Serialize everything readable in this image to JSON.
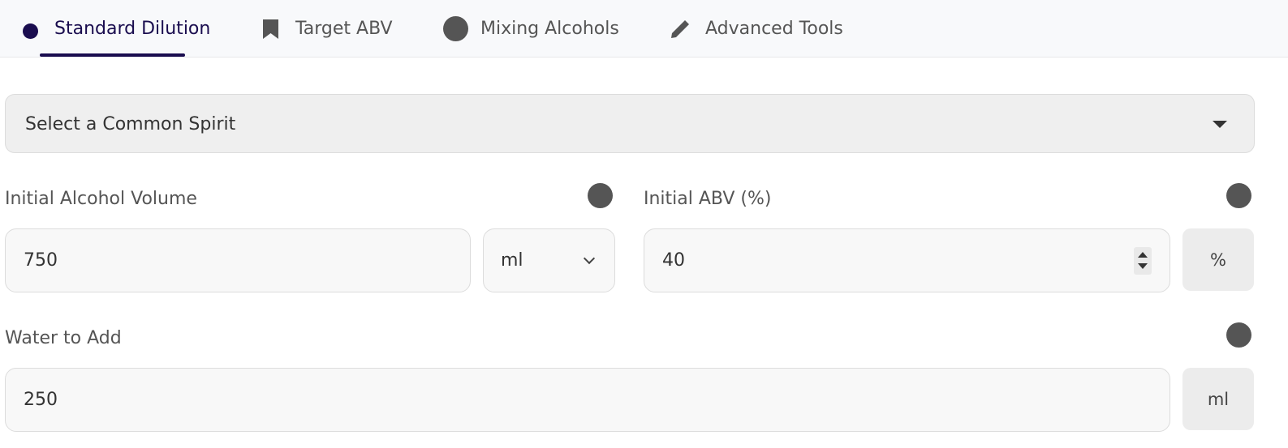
{
  "tabs": [
    {
      "label": "Standard Dilution",
      "icon": "circle-icon",
      "active": true
    },
    {
      "label": "Target ABV",
      "icon": "bookmark-icon",
      "active": false
    },
    {
      "label": "Mixing Alcohols",
      "icon": "circle-icon",
      "active": false
    },
    {
      "label": "Advanced Tools",
      "icon": "pencil-icon",
      "active": false
    }
  ],
  "spirit_select": {
    "placeholder": "Select a Common Spirit"
  },
  "initial_volume": {
    "label": "Initial Alcohol Volume",
    "value": "750",
    "unit": "ml"
  },
  "initial_abv": {
    "label": "Initial ABV (%)",
    "value": "40",
    "unit": "%"
  },
  "water_to_add": {
    "label": "Water to Add",
    "value": "250",
    "unit": "ml"
  },
  "colors": {
    "accent": "#1a0d4f",
    "info_dot": "#555555",
    "tab_bg": "#f8f9fb"
  }
}
